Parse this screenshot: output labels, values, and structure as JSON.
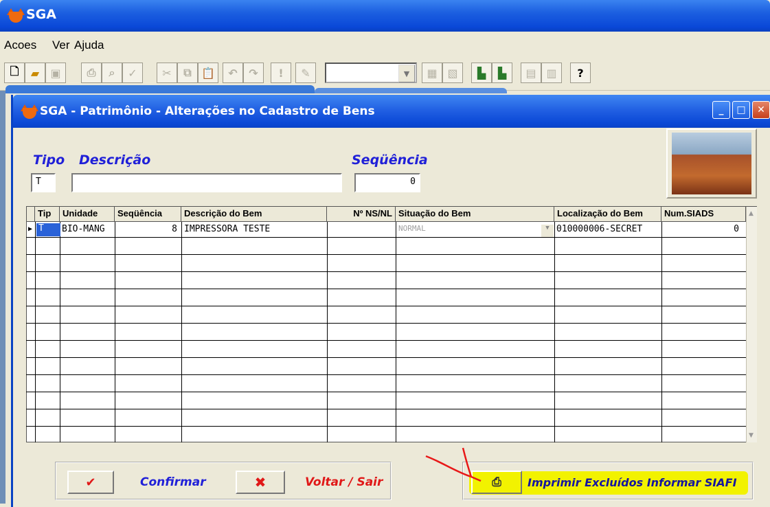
{
  "app": {
    "title": "SGA"
  },
  "menu": [
    "Acoes",
    "Ver",
    "Ajuda"
  ],
  "toolbar": {
    "icons": [
      "new-icon",
      "open-icon",
      "save-icon",
      "print-icon",
      "print-preview-icon",
      "spellcheck-icon",
      "cut-icon",
      "copy-icon",
      "paste-icon",
      "undo-icon",
      "redo-icon",
      "exclamation-icon",
      "edit-icon",
      "calc-icon",
      "image-icon",
      "building-icon",
      "building-icon",
      "report-icon",
      "report-edit-icon",
      "help-icon"
    ],
    "combo_value": "",
    "help_glyph": "?"
  },
  "child": {
    "title": "SGA - Patrimônio - Alterações no Cadastro de Bens",
    "form": {
      "tipo_label": "Tipo",
      "tipo_value": "T",
      "descricao_label": "Descrição",
      "descricao_value": "",
      "sequencia_label": "Seqüência",
      "sequencia_value": "0"
    },
    "grid": {
      "headers": [
        "Tip",
        "Unidade",
        "Seqüência",
        "Descrição do Bem",
        "Nº NS/NL",
        "Situação do Bem",
        "Localização do Bem",
        "Num.SIADS"
      ],
      "rows": [
        {
          "tipo": "T",
          "unidade": "BIO-MANG",
          "sequencia": "8",
          "descricao": "IMPRESSORA TESTE",
          "ns": "",
          "situacao": "NORMAL",
          "localizacao": "010000006-SECRET",
          "siads": "0"
        }
      ]
    },
    "buttons": {
      "confirmar": "Confirmar",
      "voltar": "Voltar / Sair",
      "imprimir": "Imprimir Excluídos Informar SIAFI"
    }
  },
  "colors": {
    "title_blue": "#0a48d8",
    "label_blue": "#2020d8",
    "red_label": "#e01818",
    "highlight": "#f2f200"
  }
}
